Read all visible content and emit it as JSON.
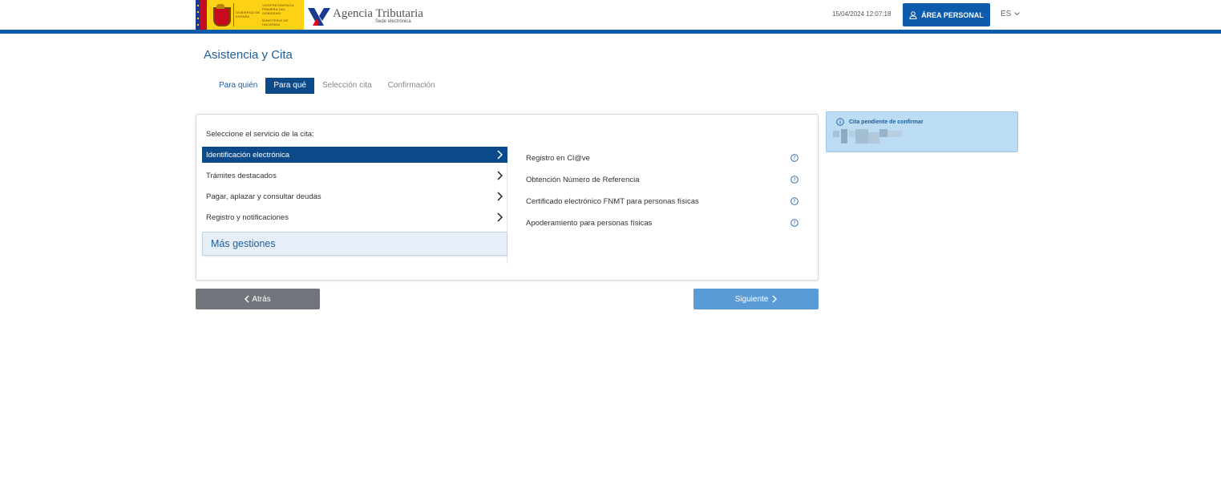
{
  "header": {
    "gov_text_1": "GOBIERNO DE ESPAÑA",
    "gov_text_2": "VICEPRESIDENCIA PRIMERA DEL GOBIERNO",
    "gov_text_3": "MINISTERIO DE HACIENDA",
    "agency_name": "Agencia Tributaria",
    "agency_subtitle": "Sede electrónica",
    "datetime": "15/04/2024 12:07:18",
    "area_personal_label": "ÁREA PERSONAL",
    "language": "ES"
  },
  "page": {
    "title": "Asistencia y Cita"
  },
  "steps": [
    {
      "label": "Para quién",
      "state": "done"
    },
    {
      "label": "Para qué",
      "state": "active"
    },
    {
      "label": "Selección cita",
      "state": "disabled"
    },
    {
      "label": "Confirmación",
      "state": "disabled"
    }
  ],
  "panel": {
    "prompt": "Seleccione el servicio de la cita:",
    "categories": [
      {
        "label": "Identificación electrónica",
        "selected": true
      },
      {
        "label": "Trámites destacados",
        "selected": false
      },
      {
        "label": "Pagar, aplazar y consultar deudas",
        "selected": false
      },
      {
        "label": "Registro y notificaciones",
        "selected": false
      }
    ],
    "more_label": "Más gestiones",
    "services": [
      {
        "label": "Registro en Cl@ve"
      },
      {
        "label": "Obtención Número de Referencia"
      },
      {
        "label": "Certificado electrónico FNMT para personas físicas"
      },
      {
        "label": "Apoderamiento para personas físicas"
      }
    ]
  },
  "buttons": {
    "back_label": "Atrás",
    "next_label": "Siguiente"
  },
  "side_card": {
    "title": "Cita pendiente de confirmar"
  },
  "colors": {
    "primary": "#0d5cab",
    "selected": "#0c4a8a",
    "link": "#1d5e9c",
    "next_button": "#5a9bd5",
    "back_button": "#6f757b",
    "side_card_bg": "#bcdcf4",
    "gov_yellow": "#fcd116"
  }
}
